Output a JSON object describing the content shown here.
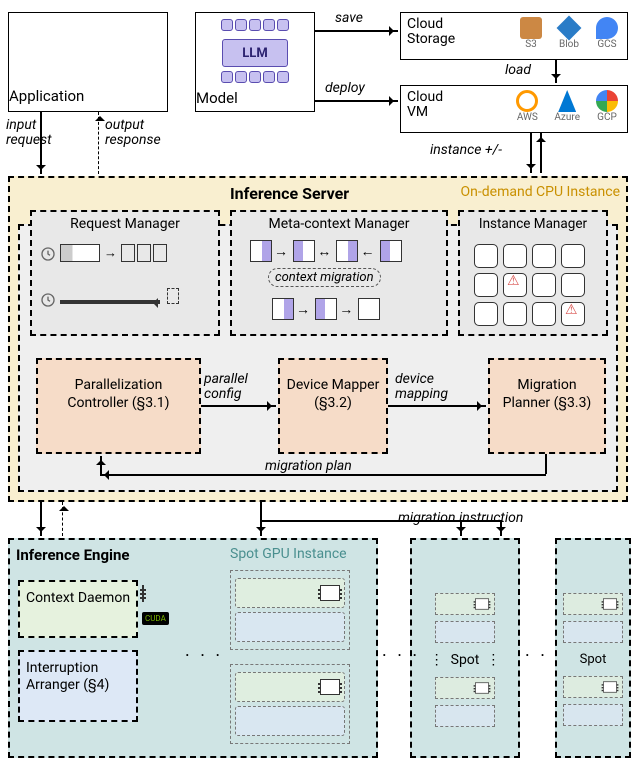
{
  "app": {
    "label": "Application"
  },
  "model": {
    "label": "Model",
    "llm": "LLM"
  },
  "cloud_storage": {
    "label": "Cloud\nStorage",
    "providers": [
      "S3",
      "Blob",
      "GCS"
    ]
  },
  "cloud_vm": {
    "label": "Cloud\nVM",
    "providers": [
      "AWS",
      "Azure",
      "GCP"
    ]
  },
  "edges": {
    "save": "save",
    "deploy": "deploy",
    "load": "load",
    "instance_pm": "instance +/-",
    "input_request": "input request",
    "output_response": "output response",
    "parallel_config": "parallel config",
    "device_mapping": "device mapping",
    "migration_plan": "migration plan",
    "migration_instruction": "migration instruction",
    "context_migration": "context migration"
  },
  "server": {
    "title": "Inference Server",
    "instance_label": "On-demand CPU Instance",
    "request_manager": "Request Manager",
    "meta_context_manager": "Meta-context Manager",
    "instance_manager": "Instance Manager",
    "parallelization_controller": "Parallelization Controller (§3.1)",
    "device_mapper": "Device Mapper (§3.2)",
    "migration_planner": "Migration Planner (§3.3)"
  },
  "engine": {
    "title": "Inference Engine",
    "spot_label": "Spot GPU Instance",
    "context_daemon": "Context Daemon",
    "interruption_arranger": "Interruption Arranger (§4)",
    "spot_short": "Spot"
  }
}
